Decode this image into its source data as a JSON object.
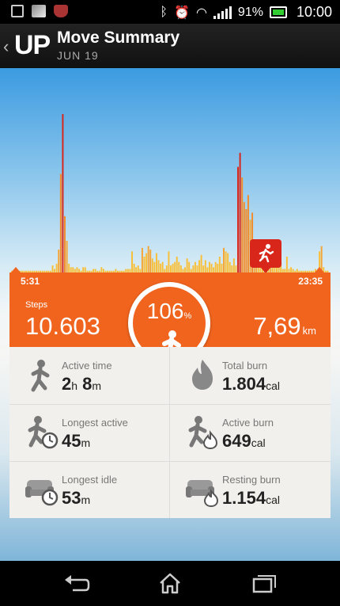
{
  "status_bar": {
    "battery": "91%",
    "time": "10:00"
  },
  "header": {
    "back_glyph": "‹",
    "logo": "UP",
    "title": "Move Summary",
    "date": "JUN 19"
  },
  "chart_data": {
    "type": "bar",
    "x": [
      "5:31",
      "23:35"
    ],
    "values": [
      1,
      1,
      1,
      1,
      1,
      1,
      1,
      1,
      1,
      1,
      1,
      1,
      1,
      1,
      1,
      1,
      1,
      1,
      1,
      1,
      4,
      2,
      5,
      13,
      56,
      90,
      32,
      18,
      5,
      3,
      3,
      2,
      3,
      2,
      1,
      3,
      3,
      1,
      1,
      1,
      2,
      2,
      1,
      1,
      3,
      2,
      1,
      1,
      1,
      1,
      1,
      2,
      1,
      1,
      1,
      1,
      2,
      2,
      2,
      12,
      5,
      3,
      4,
      2,
      14,
      9,
      11,
      15,
      13,
      8,
      6,
      11,
      7,
      5,
      6,
      2,
      4,
      12,
      4,
      5,
      6,
      9,
      6,
      4,
      2,
      3,
      8,
      6,
      2,
      4,
      6,
      4,
      7,
      10,
      4,
      7,
      3,
      6,
      5,
      3,
      6,
      5,
      9,
      5,
      14,
      12,
      11,
      6,
      4,
      8,
      4,
      60,
      68,
      54,
      40,
      36,
      44,
      30,
      34,
      14,
      15,
      8,
      6,
      10,
      14,
      8,
      2,
      16,
      6,
      4,
      4,
      3,
      6,
      2,
      2,
      9,
      2,
      3,
      2,
      1,
      2,
      1,
      1,
      1,
      1,
      1,
      1,
      1,
      1,
      2,
      1,
      12,
      15,
      3,
      1,
      1
    ],
    "peak_indices": [
      25,
      111,
      112
    ],
    "colors": {
      "low": "#f8bf3a",
      "mid": "#f4a535",
      "high": "#f28c2a",
      "peak": "#d8261b"
    }
  },
  "summary": {
    "start_time": "5:31",
    "end_time": "23:35",
    "steps_label": "Steps",
    "steps": "10.603",
    "percent": "106",
    "percent_unit": "%",
    "distance": "7,69",
    "distance_unit": "km"
  },
  "stats": [
    {
      "label": "Active time",
      "v1": "2",
      "u1": "h",
      "v2": " 8",
      "u2": "m",
      "icon": "active-time-icon"
    },
    {
      "label": "Total burn",
      "v1": "1.804",
      "u1": "cal",
      "v2": "",
      "u2": "",
      "icon": "flame-icon"
    },
    {
      "label": "Longest active",
      "v1": "45",
      "u1": "m",
      "v2": "",
      "u2": "",
      "icon": "longest-active-icon"
    },
    {
      "label": "Active burn",
      "v1": "649",
      "u1": "cal",
      "v2": "",
      "u2": "",
      "icon": "active-burn-icon"
    },
    {
      "label": "Longest idle",
      "v1": "53",
      "u1": "m",
      "v2": "",
      "u2": "",
      "icon": "couch-clock-icon"
    },
    {
      "label": "Resting burn",
      "v1": "1.154",
      "u1": "cal",
      "v2": "",
      "u2": "",
      "icon": "couch-flame-icon"
    }
  ]
}
